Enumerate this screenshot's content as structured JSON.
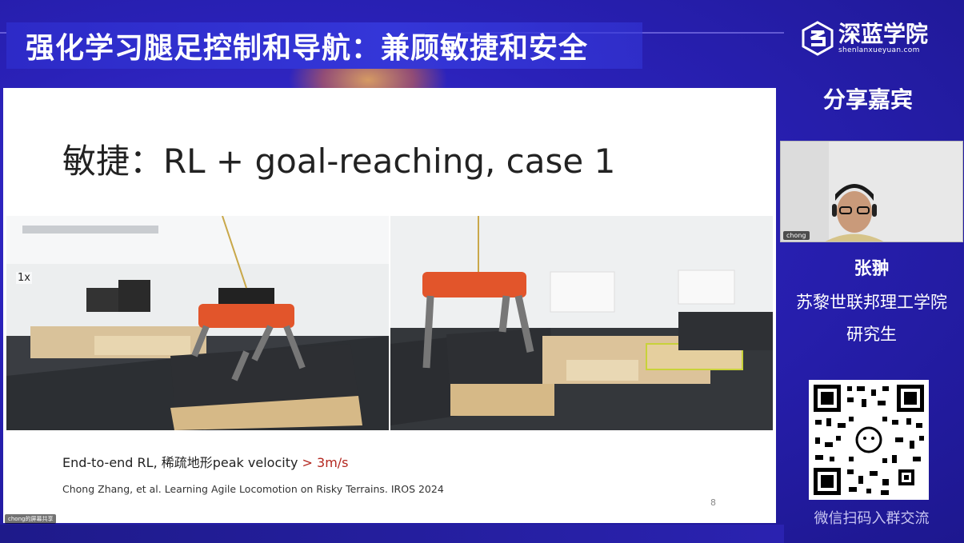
{
  "header": {
    "title": "强化学习腿足控制和导航：兼顾敏捷和安全"
  },
  "brand": {
    "name_cn": "深蓝学院",
    "name_en": "shenlanxueyuan.com"
  },
  "sidebar": {
    "guest_heading": "分享嘉宾",
    "webcam_label": "chong",
    "guest_name": "张翀",
    "guest_org": "苏黎世联邦理工学院",
    "guest_role": "研究生",
    "qr_caption": "微信扫码入群交流"
  },
  "slide": {
    "title": "敏捷：RL + goal-reaching, case 1",
    "speed_label": "1x",
    "caption_main": "End-to-end RL, 稀疏地形peak velocity ",
    "caption_highlight": "> 3m/s",
    "citation": "Chong Zhang, et al. Learning Agile Locomotion on Risky Terrains. IROS 2024",
    "page_number": "8"
  },
  "footer": {
    "presenter_label": "chong的屏幕共享"
  },
  "colors": {
    "background": "#2a21b8",
    "title_bar": "#3436d8",
    "highlight": "#b3261e",
    "robot_orange": "#e2552b"
  }
}
